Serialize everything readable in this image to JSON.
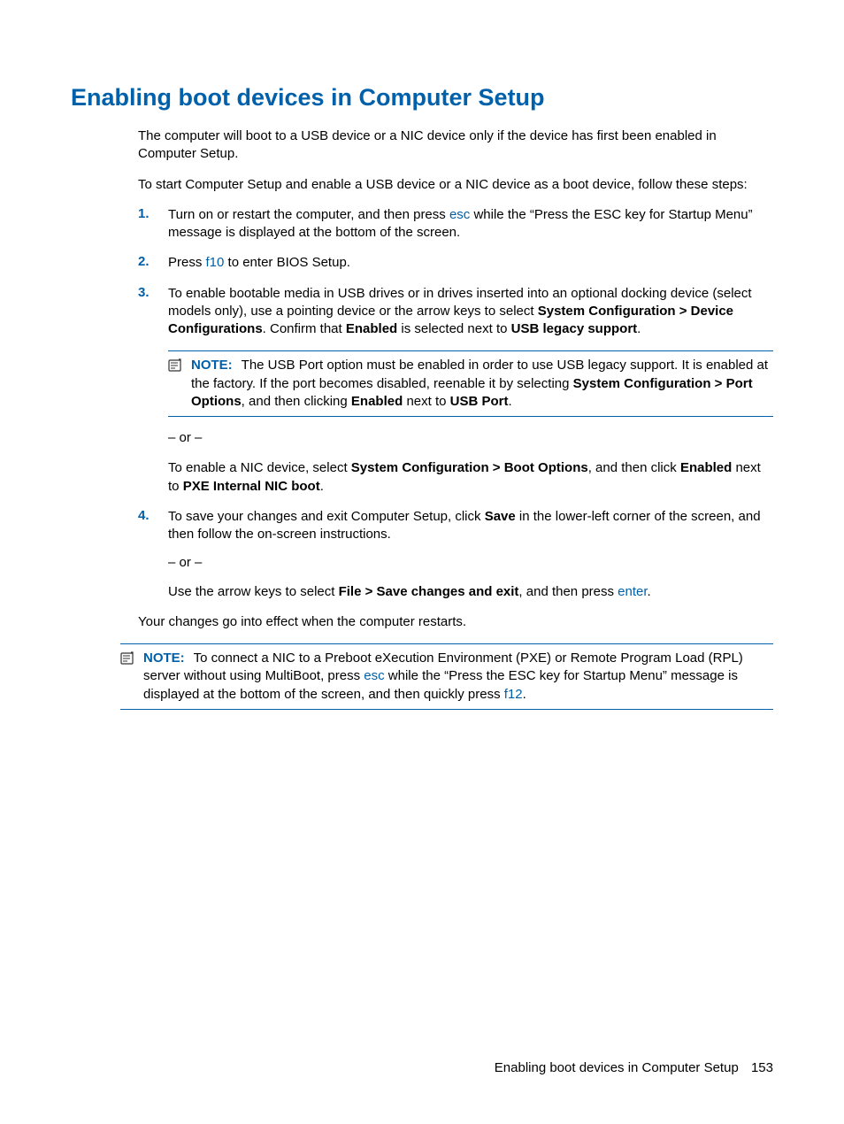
{
  "heading": "Enabling boot devices in Computer Setup",
  "intro1": "The computer will boot to a USB device or a NIC device only if the device has first been enabled in Computer Setup.",
  "intro2": "To start Computer Setup and enable a USB device or a NIC device as a boot device, follow these steps:",
  "steps": {
    "s1": {
      "num": "1.",
      "pre": "Turn on or restart the computer, and then press ",
      "key": "esc",
      "post": " while the “Press the ESC key for Startup Menu” message is displayed at the bottom of the screen."
    },
    "s2": {
      "num": "2.",
      "pre": "Press ",
      "key": "f10",
      "post": " to enter BIOS Setup."
    },
    "s3": {
      "num": "3.",
      "pre": "To enable bootable media in USB drives or in drives inserted into an optional docking device (select models only), use a pointing device or the arrow keys to select ",
      "bold1": "System Configuration > Device Configurations",
      "mid1": ". Confirm that ",
      "bold2": "Enabled",
      "mid2": " is selected next to ",
      "bold3": "USB legacy support",
      "post": "."
    },
    "note3": {
      "label": "NOTE:",
      "t1": "The USB Port option must be enabled in order to use USB legacy support. It is enabled at the factory. If the port becomes disabled, reenable it by selecting ",
      "b1": "System Configuration > Port Options",
      "t2": ", and then clicking ",
      "b2": "Enabled",
      "t3": " next to ",
      "b3": "USB Port",
      "t4": "."
    },
    "or1": "– or –",
    "nic": {
      "t1": "To enable a NIC device, select ",
      "b1": "System Configuration > Boot Options",
      "t2": ", and then click ",
      "b2": "Enabled",
      "t3": " next to ",
      "b3": "PXE Internal NIC boot",
      "t4": "."
    },
    "s4": {
      "num": "4.",
      "t1": "To save your changes and exit Computer Setup, click ",
      "b1": "Save",
      "t2": " in the lower-left corner of the screen, and then follow the on-screen instructions.",
      "or": "– or –",
      "t3": "Use the arrow keys to select ",
      "b2": "File > Save changes and exit",
      "t4": ", and then press ",
      "key": "enter",
      "t5": "."
    }
  },
  "outro": "Your changes go into effect when the computer restarts.",
  "note_end": {
    "label": "NOTE:",
    "t1": "To connect a NIC to a Preboot eXecution Environment (PXE) or Remote Program Load (RPL) server without using MultiBoot, press ",
    "k1": "esc",
    "t2": " while the “Press the ESC key for Startup Menu” message is displayed at the bottom of the screen, and then quickly press ",
    "k2": "f12",
    "t3": "."
  },
  "footer": {
    "text": "Enabling boot devices in Computer Setup",
    "page": "153"
  }
}
